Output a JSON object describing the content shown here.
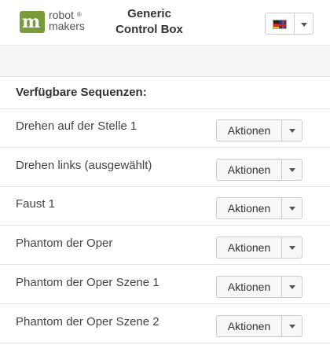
{
  "header": {
    "logo_line1": "robot",
    "logo_reg": "®",
    "logo_line2": "makers",
    "title_line1": "Generic",
    "title_line2": "Control Box"
  },
  "language_selector": {
    "flag_icon": "de-uk-flag-icon"
  },
  "sequences": {
    "heading": "Verfügbare Sequenzen:",
    "items": [
      {
        "name": "Drehen auf der Stelle 1",
        "actions_label": "Aktionen"
      },
      {
        "name": "Drehen links (ausgewählt)",
        "actions_label": "Aktionen"
      },
      {
        "name": "Faust 1",
        "actions_label": "Aktionen"
      },
      {
        "name": "Phantom der Oper",
        "actions_label": "Aktionen"
      },
      {
        "name": "Phantom der Oper Szene 1",
        "actions_label": "Aktionen"
      },
      {
        "name": "Phantom der Oper Szene 2",
        "actions_label": "Aktionen"
      }
    ]
  },
  "colors": {
    "brand_green": "#7a9a3c",
    "band_gray": "#f5f5f5"
  }
}
